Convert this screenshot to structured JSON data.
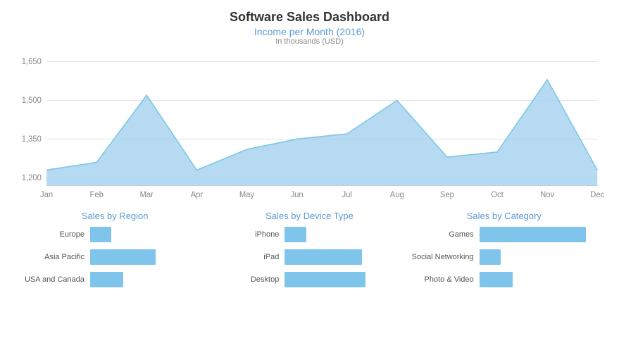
{
  "title": "Software Sales Dashboard",
  "area_chart": {
    "title": "Income per Month (2016)",
    "subtitle": "In thousands (USD)",
    "y_axis": {
      "labels": [
        "1,650",
        "1,500",
        "1,350",
        "1,200"
      ],
      "min": 1200,
      "max": 1650
    },
    "x_axis": {
      "labels": [
        "Jan",
        "Feb",
        "Mar",
        "Apr",
        "May",
        "Jun",
        "Jul",
        "Aug",
        "Sep",
        "Oct",
        "Nov",
        "Dec"
      ]
    },
    "data_points": [
      1230,
      1260,
      1520,
      1230,
      1310,
      1350,
      1370,
      1500,
      1280,
      1300,
      1580,
      1230
    ]
  },
  "bar_charts": {
    "sales_by_region": {
      "title": "Sales by Region",
      "bars": [
        {
          "label": "Europe",
          "value": 18
        },
        {
          "label": "Asia Pacific",
          "value": 55
        },
        {
          "label": "USA and Canada",
          "value": 28
        }
      ]
    },
    "sales_by_device": {
      "title": "Sales by Device Type",
      "bars": [
        {
          "label": "iPhone",
          "value": 18
        },
        {
          "label": "iPad",
          "value": 65
        },
        {
          "label": "Desktop",
          "value": 68
        }
      ]
    },
    "sales_by_category": {
      "title": "Sales by Category",
      "bars": [
        {
          "label": "Games",
          "value": 90
        },
        {
          "label": "Social Networking",
          "value": 18
        },
        {
          "label": "Photo & Video",
          "value": 28
        }
      ]
    }
  }
}
